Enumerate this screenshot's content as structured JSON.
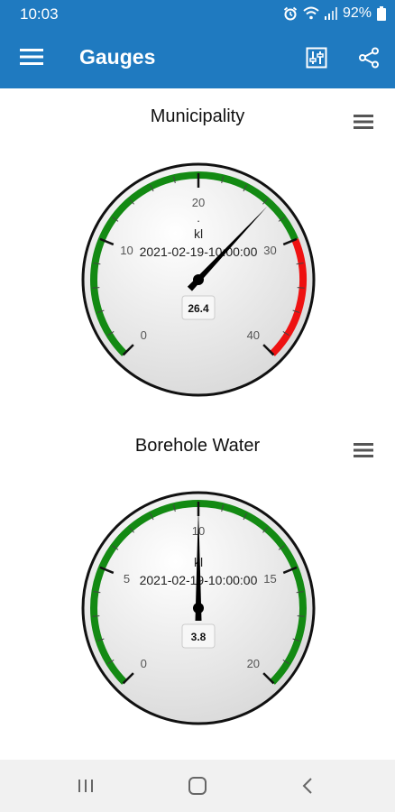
{
  "status": {
    "time": "10:03",
    "battery": "92%"
  },
  "appbar": {
    "title": "Gauges"
  },
  "gauges": [
    {
      "title": "Municipality",
      "ticks": [
        "0",
        "10",
        "20",
        "30",
        "40"
      ],
      "min": 0,
      "max": 40,
      "green_band": [
        0,
        30
      ],
      "red_band": [
        30,
        40
      ],
      "unit_dot": ".",
      "unit": "kl",
      "timestamp": "2021-02-19-10:00:00",
      "value_label": "26.4",
      "value": 26.4
    },
    {
      "title": "Borehole Water",
      "ticks": [
        "0",
        "5",
        "10",
        "15",
        "20"
      ],
      "min": 0,
      "max": 20,
      "green_band": [
        0,
        20
      ],
      "red_band": null,
      "unit_dot": ".",
      "unit": "kl",
      "timestamp": "2021-02-19-10:00:00",
      "value_label": "3.8",
      "value": 10
    }
  ],
  "colors": {
    "primary": "#1f7ac0",
    "green": "#138a13",
    "red": "#ee1111"
  },
  "icons": [
    "hamburger-menu-icon",
    "tune-icon",
    "share-icon",
    "alarm-icon",
    "wifi-icon",
    "signal-icon",
    "battery-icon",
    "context-menu-icon",
    "nav-recents-icon",
    "nav-home-icon",
    "nav-back-icon"
  ]
}
